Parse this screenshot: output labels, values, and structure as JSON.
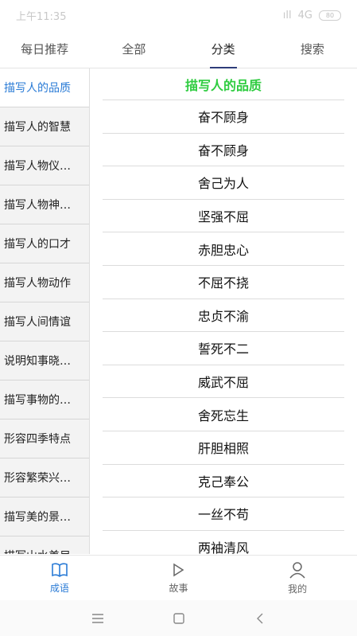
{
  "status": {
    "time": "上午11:35",
    "network": "4G",
    "battery": "80"
  },
  "tabs": [
    {
      "label": "每日推荐"
    },
    {
      "label": "全部"
    },
    {
      "label": "分类"
    },
    {
      "label": "搜索"
    }
  ],
  "sidebar": {
    "items": [
      {
        "label": "描写人的品质"
      },
      {
        "label": "描写人的智慧"
      },
      {
        "label": "描写人物仪…"
      },
      {
        "label": "描写人物神…"
      },
      {
        "label": "描写人的口才"
      },
      {
        "label": "描写人物动作"
      },
      {
        "label": "描写人间情谊"
      },
      {
        "label": "说明知事晓…"
      },
      {
        "label": "描写事物的…"
      },
      {
        "label": "形容四季特点"
      },
      {
        "label": "形容繁荣兴…"
      },
      {
        "label": "描写美的景…"
      },
      {
        "label": "描写山水美目"
      }
    ]
  },
  "main": {
    "header": "描写人的品质",
    "idioms": [
      "奋不顾身",
      "奋不顾身",
      "舍己为人",
      "坚强不屈",
      "赤胆忠心",
      "不屈不挠",
      "忠贞不渝",
      "誓死不二",
      "威武不屈",
      "舍死忘生",
      "肝胆相照",
      "克己奉公",
      "一丝不苟",
      "两袖清风"
    ]
  },
  "bottom_nav": [
    {
      "label": "成语",
      "icon": "book-icon"
    },
    {
      "label": "故事",
      "icon": "play-icon"
    },
    {
      "label": "我的",
      "icon": "user-icon"
    }
  ],
  "colors": {
    "accent": "#2a7bd6",
    "header_green": "#2ecc40",
    "tab_underline": "#2e3d7a"
  }
}
